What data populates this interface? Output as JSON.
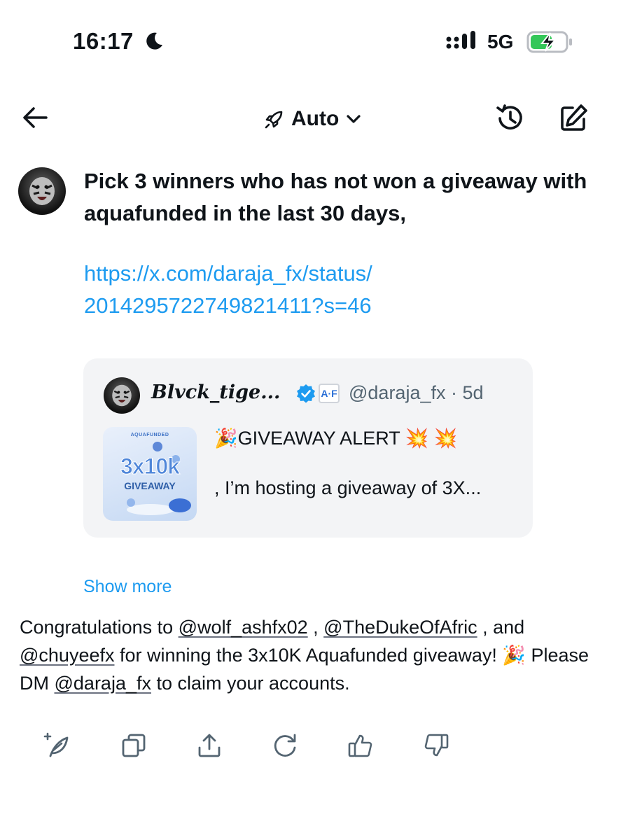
{
  "status_bar": {
    "time": "16:17",
    "network": "5G"
  },
  "nav": {
    "mode_label": "Auto"
  },
  "prompt": {
    "text": "Pick 3 winners who has not won a giveaway with aquafunded  in the last 30 days,",
    "link_line1": "https://x.com/daraja_fx/status/",
    "link_line2": "2014295722749821411?s=46"
  },
  "quote": {
    "name": "𝑩𝒍𝒗𝒄𝒌_𝒕𝒊𝒈𝒆...",
    "badge": "A·F",
    "handle_time": "@daraja_fx · 5d",
    "text_line1": "🎉GIVEAWAY ALERT 💥 💥",
    "text_line2": ", I’m hosting a giveaway of  3X...",
    "thumb_brand": "AQUAFUNDED",
    "thumb_big": "3x10k",
    "thumb_sub": "GIVEAWAY"
  },
  "show_more": "Show more",
  "answer": {
    "t1": "Congratulations to ",
    "m1": "@wolf_ashfx02",
    "t2": " , ",
    "m2": "@TheDukeOfAfric",
    "t3": " , and ",
    "m3": "@chuyeefx",
    "t4": "  for winning the 3x10K Aquafunded giveaway! 🎉 Please DM ",
    "m4": "@daraja_fx",
    "t5": "  to claim your accounts."
  },
  "icons": {
    "back": "arrow-left-icon",
    "mode": "rocket-icon",
    "history": "history-icon",
    "edit": "compose-icon",
    "toolbar": [
      "regenerate-feather-icon",
      "copy-icon",
      "share-icon",
      "refresh-icon",
      "thumbs-up-icon",
      "thumbs-down-icon"
    ]
  },
  "colors": {
    "link": "#1d9bf0",
    "text": "#0f1419",
    "muted": "#536471",
    "card": "#f3f4f6",
    "battery": "#34c759"
  }
}
